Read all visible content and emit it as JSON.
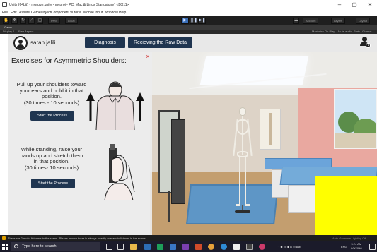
{
  "window": {
    "title": "Unity (64bit) - morgue.unity - myproj - PC, Mac & Linux Standalone* <DX11>",
    "minimize": "–",
    "maximize": "▢",
    "close": "✕"
  },
  "menu": [
    "File",
    "Edit",
    "Assets",
    "GameObject",
    "Component",
    "Vuforia",
    "Mobile Input",
    "Window",
    "Help"
  ],
  "toolbar": {
    "pivot": "Pivot",
    "local": "Local",
    "account": "Account",
    "layers": "Layers",
    "layout": "Layout"
  },
  "game_panel": {
    "tab": "Game",
    "display": "Display 1",
    "aspect": "Free Aspect",
    "maximize": "Maximize On Play",
    "mute": "Mute audio",
    "stats": "Stats",
    "gizmos": "Gizmos"
  },
  "header": {
    "username": "sarah jalili",
    "diagnosis": "Diagnosis",
    "raw_data": "Recieving the Raw Data"
  },
  "exercise": {
    "title": "Exercises for Asymmetric Shoulders:",
    "close": "×",
    "items": [
      {
        "line1": "Pull up your shoulders toward",
        "line2": "your ears and hold it in that",
        "line3": "position.",
        "line4": "(30 times - 10 seconds)",
        "button": "Start the Process"
      },
      {
        "line1": "While standing, raise your",
        "line2": "hands up and stretch them",
        "line3": "in that position.",
        "line4": "(30 times- 10 seconds)",
        "button": "Start the Process"
      }
    ]
  },
  "console": {
    "message": "There are 2 audio listeners in the scene. Please ensure there is always exactly one audio listener in the scene.",
    "right": "Auto Generate Lighting Off"
  },
  "taskbar": {
    "search_placeholder": "Type here to search",
    "lang": "ENG",
    "time": "5:24 AM",
    "date": "6/5/2018"
  },
  "colors": {
    "navy_button": "#1f3550",
    "close_red": "#d13030",
    "highlight": "#ffff00"
  }
}
